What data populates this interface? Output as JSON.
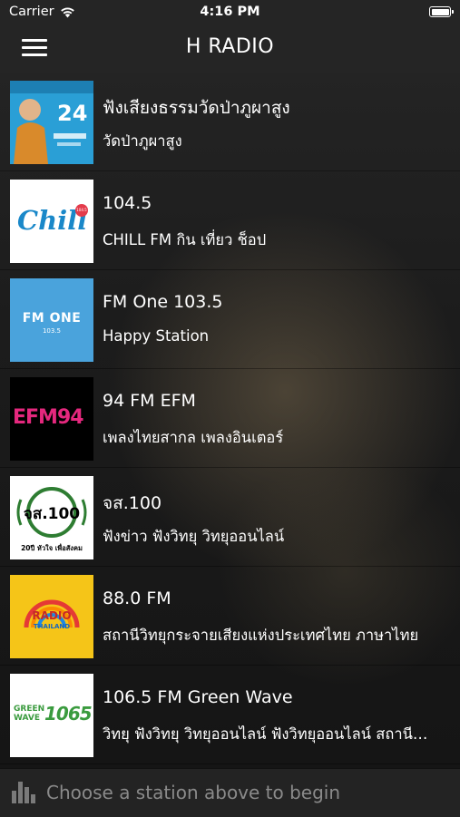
{
  "status_bar": {
    "carrier": "Carrier",
    "time": "4:16 PM"
  },
  "nav": {
    "title": "H RADIO"
  },
  "stations": [
    {
      "name": "ฟังเสียงธรรมวัดป่าภูผาสูง",
      "description": "วัดป่าภูผาสูง",
      "logo_text": "24",
      "logo_bg": "#2a9fd6",
      "icon": "monk-photo-icon"
    },
    {
      "name": "104.5",
      "description": "CHILL FM กิน เที่ยว ช็อป",
      "logo_text": "Chill",
      "logo_badge": "104.5",
      "logo_bg": "#ffffff",
      "logo_fg": "#1a88c9",
      "icon": "chill-fm-logo-icon"
    },
    {
      "name": "FM One 103.5",
      "description": "Happy Station",
      "logo_text": "FM ONE",
      "logo_sub": "103.5",
      "logo_bg": "#4aa3dc",
      "icon": "fm-one-logo-icon"
    },
    {
      "name": "94 FM EFM",
      "description": "เพลงไทยสากล เพลงอินเตอร์",
      "logo_text": "EFM94",
      "logo_bg": "#000000",
      "logo_fg": "#e5287e",
      "icon": "efm-logo-icon"
    },
    {
      "name": "จส.100",
      "description": "ฟังข่าว ฟังวิทยุ วิทยุออนไลน์",
      "logo_text": "จส.100",
      "logo_sub": "20ปี หัวใจ เพื่อสังคม",
      "logo_bg": "#ffffff",
      "icon": "js100-logo-icon"
    },
    {
      "name": "88.0 FM",
      "description": "สถานีวิทยุกระจายเสียงแห่งประเทศไทย ภาษาไทย",
      "logo_text": "RADIO",
      "logo_sub": "THAILAND",
      "logo_bg": "#f5c518",
      "icon": "radio-thailand-logo-icon"
    },
    {
      "name": "106.5 FM Green Wave",
      "description": "วิทยุ ฟังวิทยุ วิทยุออนไลน์ ฟังวิทยุออนไลน์ สถานีวิทยุ",
      "logo_text": "GREEN WAVE",
      "logo_sub": "1065",
      "logo_bg": "#ffffff",
      "logo_fg": "#3a9b3e",
      "icon": "green-wave-logo-icon"
    }
  ],
  "player": {
    "prompt": "Choose a station above to begin",
    "icon": "equalizer-icon"
  },
  "colors": {
    "bar_background": "#252525",
    "text_primary": "#ffffff",
    "text_muted": "#8a8a8a"
  }
}
